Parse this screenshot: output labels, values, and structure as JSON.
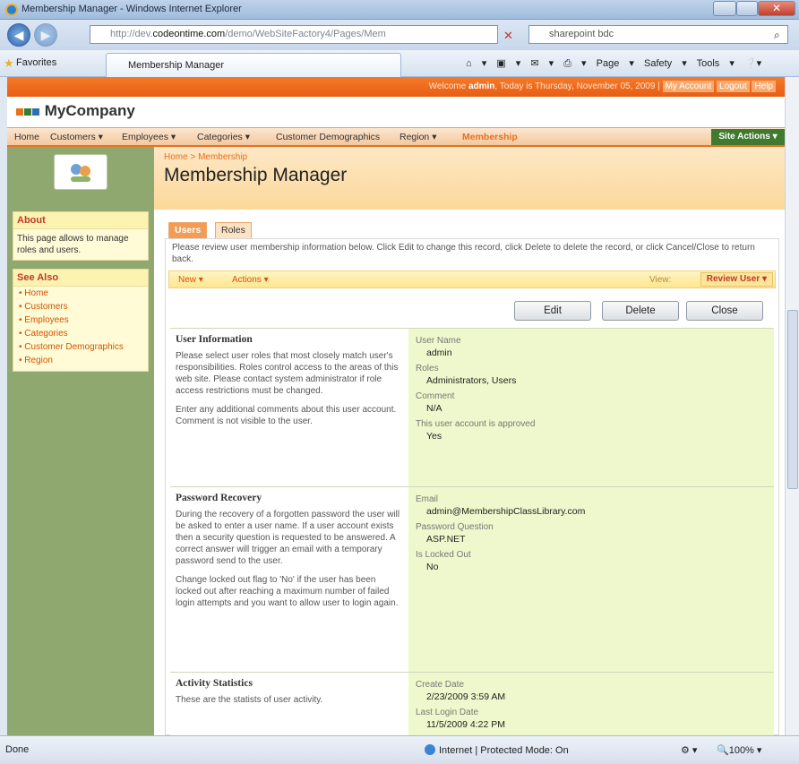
{
  "window": {
    "title": "Membership Manager - Windows Internet Explorer"
  },
  "address": {
    "url_prefix": "http://dev.",
    "url_domain": "codeontime.com",
    "url_rest": "/demo/WebSiteFactory4/Pages/Mem",
    "search": "sharepoint bdc"
  },
  "cmdbar": {
    "favorites": "Favorites",
    "tab_title": "Membership Manager",
    "page": "Page ▾",
    "safety": "Safety ▾",
    "tools": "Tools ▾"
  },
  "site": {
    "welcome_prefix": "Welcome ",
    "user": "admin",
    "welcome_suffix": ", Today is Thursday, November 05, 2009 |",
    "my_account": "My Account",
    "logout": "Logout",
    "help": "Help",
    "company": "MyCompany",
    "site_actions": "Site Actions ▾"
  },
  "menu": [
    "Home",
    "Customers ▾",
    "Employees ▾",
    "Categories ▾",
    "Customer Demographics",
    "Region ▾",
    "Membership"
  ],
  "sidebar": {
    "about_title": "About",
    "about_text": "This page allows to manage roles and users.",
    "see_also_title": "See Also",
    "links": [
      "• Home",
      "• Customers",
      "• Employees",
      "• Categories",
      "• Customer Demographics",
      "• Region"
    ]
  },
  "breadcrumb": "Home > Membership",
  "page_title": "Membership Manager",
  "tabs": [
    "Users",
    "Roles"
  ],
  "description": "Please review user membership information below. Click Edit to change this record, click Delete to delete the record, or click Cancel/Close to return back.",
  "actionbar": {
    "new": "New ▾",
    "actions": "Actions ▾",
    "view_label": "View:",
    "view_value": "Review User ▾"
  },
  "buttons": {
    "edit": "Edit",
    "delete": "Delete",
    "close": "Close"
  },
  "sections": {
    "user_info": {
      "title": "User Information",
      "p1": "Please select user roles that most closely match user's responsibilities. Roles control access to the areas of this web site. Please contact system administrator if role access restrictions must be changed.",
      "p2": "Enter any additional comments about this user account. Comment is not visible to the user.",
      "fields": [
        {
          "label": "User Name",
          "value": "admin"
        },
        {
          "label": "Roles",
          "value": "Administrators, Users"
        },
        {
          "label": "Comment",
          "value": "N/A"
        },
        {
          "label": "This user account is approved",
          "value": "Yes"
        }
      ]
    },
    "password": {
      "title": "Password Recovery",
      "p1": "During the recovery of a forgotten password the user will be asked to enter a user name. If a user account exists then a security question is requested to be answered. A correct answer will trigger an email with a temporary password send to the user.",
      "p2": "Change locked out flag to 'No' if the user has been locked out after reaching a maximum number of failed login attempts and you want to allow user to login again.",
      "fields": [
        {
          "label": "Email",
          "value": "admin@MembershipClassLibrary.com"
        },
        {
          "label": "Password Question",
          "value": "ASP.NET"
        },
        {
          "label": "Is Locked Out",
          "value": "No"
        }
      ]
    },
    "activity": {
      "title": "Activity Statistics",
      "p1": "These are the statists of user activity.",
      "fields": [
        {
          "label": "Create Date",
          "value": "2/23/2009 3:59 AM"
        },
        {
          "label": "Last Login Date",
          "value": "11/5/2009 4:22 PM"
        }
      ]
    }
  },
  "status": {
    "left": "Done",
    "zone": "Internet | Protected Mode: On",
    "zoom": "100%"
  }
}
